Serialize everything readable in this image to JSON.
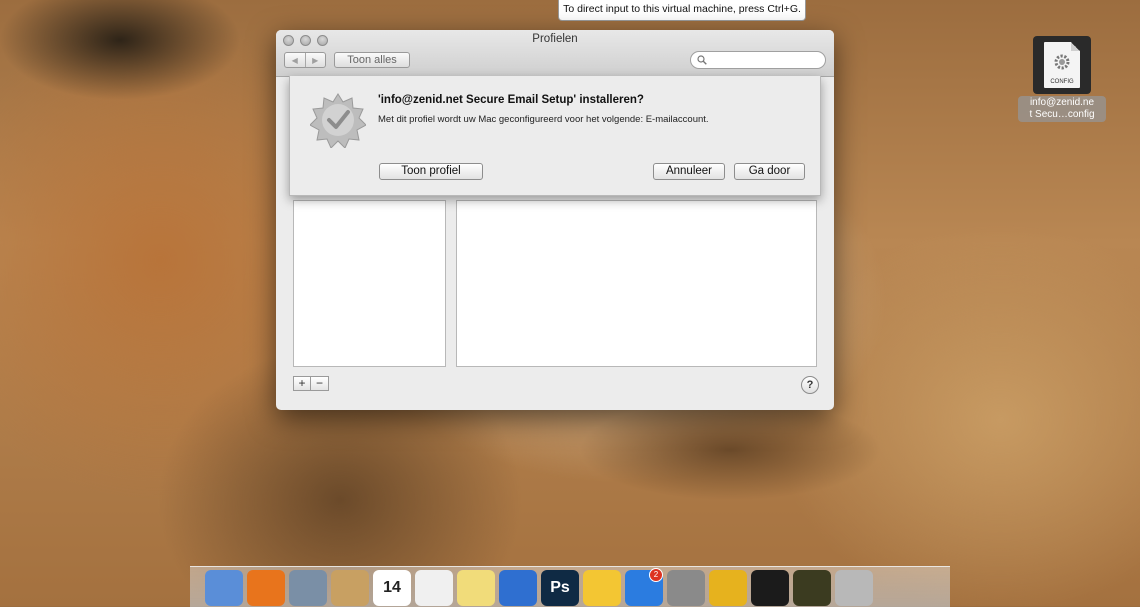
{
  "vm_notice": "To direct input to this virtual machine, press Ctrl+G.",
  "window": {
    "title": "Profielen",
    "show_all": "Toon alles",
    "search_placeholder": ""
  },
  "sheet": {
    "title": "'info@zenid.net Secure Email Setup' installeren?",
    "message": "Met dit profiel wordt uw Mac geconfigureerd voor het volgende: E-mailaccount.",
    "show_profile_button": "Toon profiel",
    "cancel_button": "Annuleer",
    "continue_button": "Ga door"
  },
  "bottom": {
    "add": "+",
    "remove": "−",
    "help": "?"
  },
  "desktop_file": {
    "doc_label": "CONFIG",
    "name_line1": "info@zenid.ne",
    "name_line2": "t Secu…config"
  },
  "dock": {
    "items": [
      {
        "name": "finder-icon",
        "color": "#5a8ed8"
      },
      {
        "name": "firefox-icon",
        "color": "#e8741c"
      },
      {
        "name": "mail-icon",
        "color": "#7a8fa6"
      },
      {
        "name": "address-book-icon",
        "color": "#c8a062"
      },
      {
        "name": "calendar-icon",
        "color": "#ffffff",
        "label": "14"
      },
      {
        "name": "reminders-icon",
        "color": "#f0f0f0"
      },
      {
        "name": "notes-icon",
        "color": "#f1dc7a"
      },
      {
        "name": "itunes-icon",
        "color": "#2f6fd0"
      },
      {
        "name": "photoshop-icon",
        "color": "#0f2a44",
        "label": "Ps"
      },
      {
        "name": "cyberduck-icon",
        "color": "#f3c633"
      },
      {
        "name": "app-store-icon",
        "color": "#2b7ce0",
        "badge": "2"
      },
      {
        "name": "system-preferences-icon",
        "color": "#8a8a8a"
      },
      {
        "name": "opera-icon",
        "color": "#e6b21e"
      },
      {
        "name": "terminal-icon",
        "color": "#1b1b1b"
      },
      {
        "name": "radar-icon",
        "color": "#3b3b20"
      },
      {
        "name": "trash-icon",
        "color": "#b8b8b8"
      }
    ]
  }
}
